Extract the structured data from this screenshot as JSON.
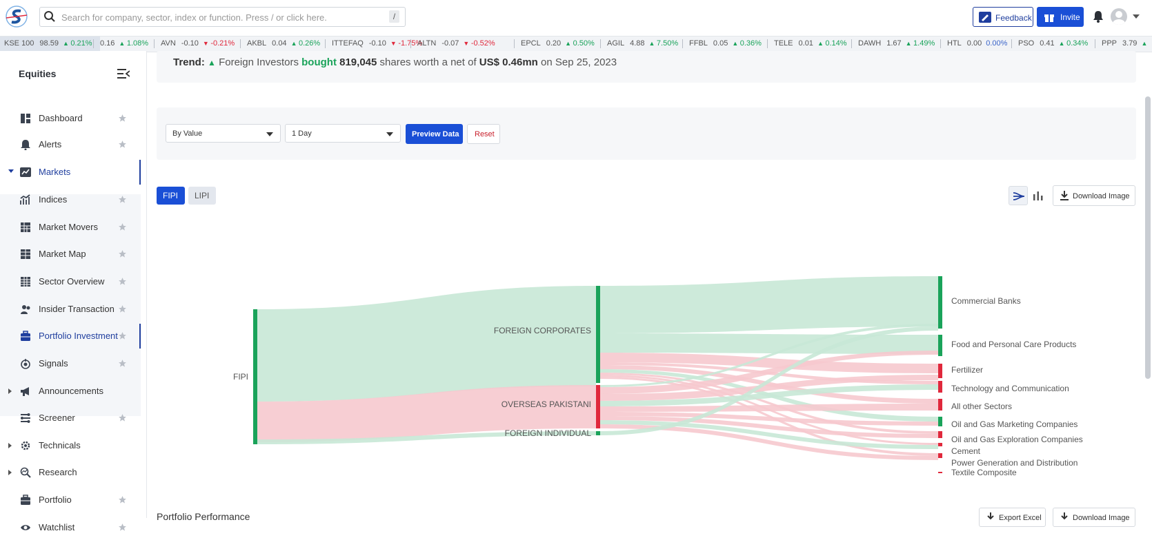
{
  "search": {
    "placeholder": "Search for company, sector, index or function. Press / or click here.",
    "shortcut": "/"
  },
  "header": {
    "feedback_label": "Feedback",
    "invite_label": "Invite"
  },
  "ticker": [
    {
      "sym": "KSE 100",
      "val": "98.59",
      "chg": "0.21%",
      "dir": "up"
    },
    {
      "sym": "",
      "val": "0.16",
      "chg": "1.08%",
      "dir": "up"
    },
    {
      "sym": "AVN",
      "val": "-0.10",
      "chg": "-0.21%",
      "dir": "dn"
    },
    {
      "sym": "AKBL",
      "val": "0.04",
      "chg": "0.26%",
      "dir": "up"
    },
    {
      "sym": "ITTEFAQ",
      "val": "-0.10",
      "chg": "-1.75%",
      "dir": "dn"
    },
    {
      "sym": "ALTN",
      "val": "-0.07",
      "chg": "-0.52%",
      "dir": "dn"
    },
    {
      "sym": "EPCL",
      "val": "0.20",
      "chg": "0.50%",
      "dir": "up"
    },
    {
      "sym": "AGIL",
      "val": "4.88",
      "chg": "7.50%",
      "dir": "up"
    },
    {
      "sym": "FFBL",
      "val": "0.05",
      "chg": "0.36%",
      "dir": "up"
    },
    {
      "sym": "TELE",
      "val": "0.01",
      "chg": "0.14%",
      "dir": "up"
    },
    {
      "sym": "DAWH",
      "val": "1.67",
      "chg": "1.49%",
      "dir": "up"
    },
    {
      "sym": "HTL",
      "val": "0.00",
      "chg": "0.00%",
      "dir": "flat"
    },
    {
      "sym": "PSO",
      "val": "0.41",
      "chg": "0.34%",
      "dir": "up"
    },
    {
      "sym": "PPP",
      "val": "3.79",
      "chg": "",
      "dir": "up"
    }
  ],
  "sidebar": {
    "title": "Equities",
    "items": [
      {
        "label": "Dashboard",
        "icon": "dashboard-icon"
      },
      {
        "label": "Alerts",
        "icon": "bell-icon"
      },
      {
        "label": "Markets",
        "icon": "chart-line-icon"
      },
      {
        "label": "Indices",
        "icon": "indices-icon"
      },
      {
        "label": "Market Movers",
        "icon": "grid-icon"
      },
      {
        "label": "Market Map",
        "icon": "map-grid-icon"
      },
      {
        "label": "Sector Overview",
        "icon": "table-icon"
      },
      {
        "label": "Insider Transaction",
        "icon": "users-icon"
      },
      {
        "label": "Portfolio Investment",
        "icon": "briefcase-icon"
      },
      {
        "label": "Signals",
        "icon": "signal-icon"
      },
      {
        "label": "Announcements",
        "icon": "megaphone-icon"
      },
      {
        "label": "Screener",
        "icon": "screener-icon"
      },
      {
        "label": "Technicals",
        "icon": "gear-chart-icon"
      },
      {
        "label": "Research",
        "icon": "magnifier-chart-icon"
      },
      {
        "label": "Portfolio",
        "icon": "portfolio-icon"
      },
      {
        "label": "Watchlist",
        "icon": "eye-icon"
      }
    ]
  },
  "trend": {
    "label": "Trend:",
    "text1": "Foreign Investors",
    "action": "bought",
    "shares": "819,045",
    "text2": "shares worth a net of",
    "amount": "US$ 0.46mn",
    "text3": "on Sep 25, 2023"
  },
  "filters": {
    "type_value": "By Value",
    "period_value": "1 Day",
    "preview_label": "Preview Data",
    "reset_label": "Reset"
  },
  "tabs": [
    "FIPI",
    "LIPI"
  ],
  "download_label": "Download Image",
  "colors": {
    "buy": "#1aa35a",
    "sell": "#e0283c",
    "buy_link": "#c8e8d6",
    "sell_link": "#f6c9ce",
    "accent": "#1a4fd6"
  },
  "chart_data": {
    "type": "sankey",
    "source": "FIPI",
    "investor_types": [
      "FOREIGN CORPORATES",
      "OVERSEAS PAKISTANI",
      "FOREIGN INDIVIDUAL"
    ],
    "sectors": [
      "Commercial Banks",
      "Food and Personal Care Products",
      "Fertilizer",
      "Technology and Communication",
      "All other Sectors",
      "Oil and Gas Marketing Companies",
      "Oil and Gas Exploration Companies",
      "Cement",
      "Power Generation and Distribution",
      "Textile Composite"
    ]
  },
  "portfolio_performance": {
    "title": "Portfolio Performance",
    "export_label": "Export Excel",
    "download_label": "Download Image"
  }
}
